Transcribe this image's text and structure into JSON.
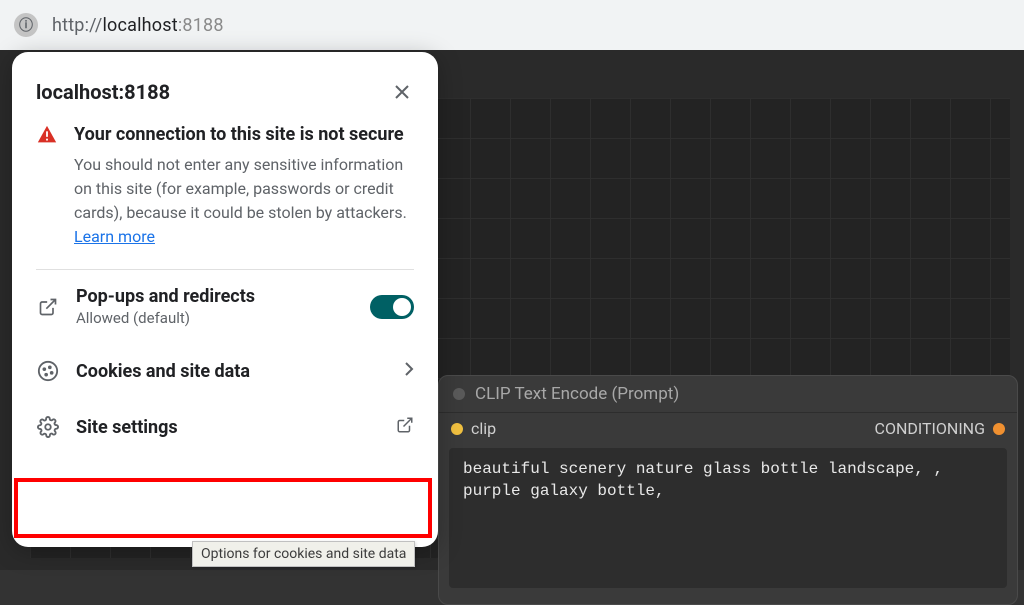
{
  "address_bar": {
    "protocol": "http://",
    "host": "localhost",
    "port": ":8188"
  },
  "popup": {
    "title": "localhost:8188",
    "warning_title": "Your connection to this site is not secure",
    "warning_desc": "You should not enter any sensitive information on this site (for example, passwords or credit cards), because it could be stolen by attackers. ",
    "learn_more": "Learn more",
    "popups_row": {
      "label": "Pop-ups and redirects",
      "sub": "Allowed (default)"
    },
    "cookies_row": {
      "label": "Cookies and site data"
    },
    "settings_row": {
      "label": "Site settings"
    }
  },
  "tooltip": {
    "text": "Options for cookies and site data"
  },
  "node": {
    "title": "CLIP Text Encode (Prompt)",
    "input_port": "clip",
    "output_port": "CONDITIONING",
    "text": "beautiful scenery nature glass bottle landscape, , purple galaxy bottle,"
  }
}
